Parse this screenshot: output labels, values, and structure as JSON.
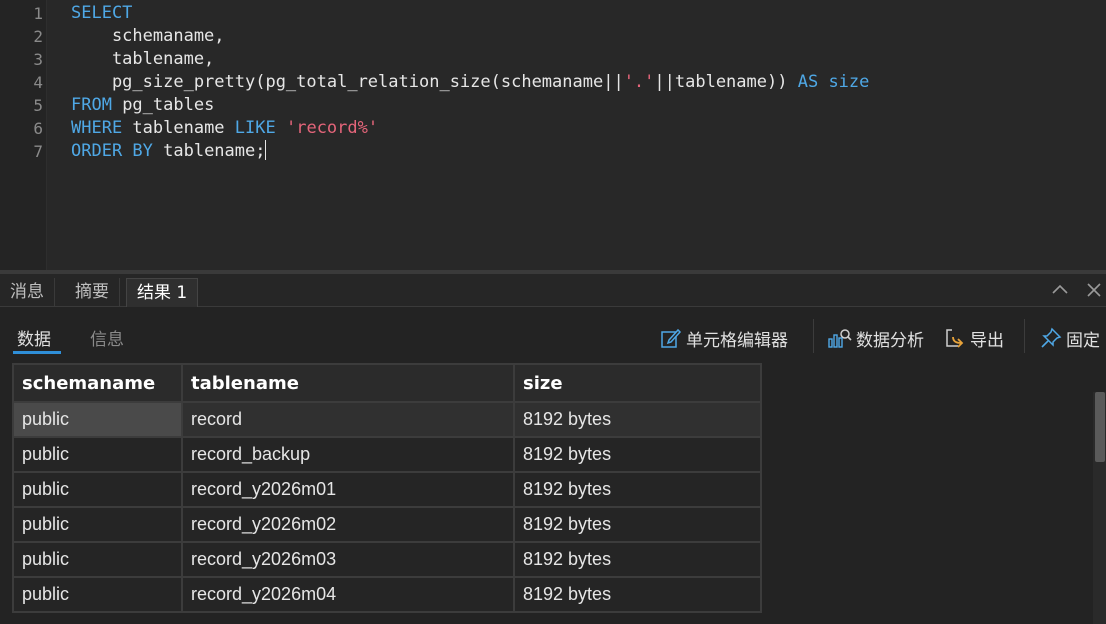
{
  "editor": {
    "line_numbers": [
      "1",
      "2",
      "3",
      "4",
      "5",
      "6",
      "7"
    ],
    "lines": {
      "l1": {
        "kw": "SELECT"
      },
      "l2": {
        "text": "    schemaname,"
      },
      "l3": {
        "text": "    tablename,"
      },
      "l4": {
        "pre": "    pg_size_pretty(pg_total_relation_size(schemaname||",
        "str": "'.'",
        "mid": "||tablename)) ",
        "kw": "AS",
        "kw2": "size"
      },
      "l5": {
        "kw": "FROM",
        "text": " pg_tables"
      },
      "l6": {
        "kw": "WHERE",
        "text": " tablename ",
        "kw2": "LIKE",
        "str": "'record%'"
      },
      "l7": {
        "kw": "ORDER BY",
        "text": " tablename;"
      }
    }
  },
  "bottom_tabs": [
    "消息",
    "摘要",
    "结果 1"
  ],
  "result_toolbar": {
    "tabs": [
      "数据",
      "信息"
    ],
    "cell_editor": "单元格编辑器",
    "data_analysis": "数据分析",
    "export": "导出",
    "pin": "固定"
  },
  "grid": {
    "columns": [
      "schemaname",
      "tablename",
      "size"
    ],
    "rows": [
      [
        "public",
        "record",
        "8192 bytes"
      ],
      [
        "public",
        "record_backup",
        "8192 bytes"
      ],
      [
        "public",
        "record_y2026m01",
        "8192 bytes"
      ],
      [
        "public",
        "record_y2026m02",
        "8192 bytes"
      ],
      [
        "public",
        "record_y2026m03",
        "8192 bytes"
      ],
      [
        "public",
        "record_y2026m04",
        "8192 bytes"
      ]
    ]
  },
  "colors": {
    "keyword": "#4fa8e6",
    "string": "#e5657a",
    "accent": "#2f8fd8"
  },
  "icons": [
    "cell-editor-icon",
    "data-analysis-icon",
    "export-icon",
    "pin-icon",
    "chevron-up-icon",
    "close-icon"
  ]
}
